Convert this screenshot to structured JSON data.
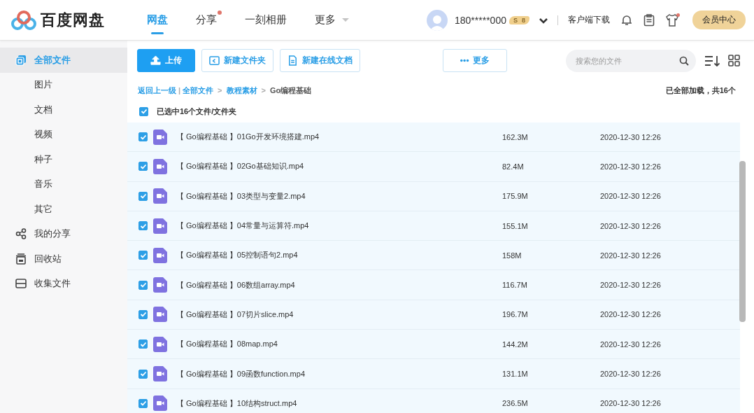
{
  "header": {
    "logo": "百度网盘",
    "tabs": [
      {
        "label": "网盘",
        "selected": true,
        "dot": false,
        "has_menu": false
      },
      {
        "label": "分享",
        "selected": false,
        "dot": true,
        "has_menu": false
      },
      {
        "label": "一刻相册",
        "selected": false,
        "dot": false,
        "has_menu": false
      },
      {
        "label": "更多",
        "selected": false,
        "dot": false,
        "has_menu": true
      }
    ],
    "user": "180*****000",
    "vip_badge": {
      "tier": "S",
      "level": "8"
    },
    "download": "客户端下载",
    "shirt_dot": true,
    "member_button": "会员中心"
  },
  "sidebar": {
    "items": [
      {
        "label": "全部文件",
        "kind": "files",
        "selected": true,
        "children": [
          {
            "label": "图片",
            "selected": false
          },
          {
            "label": "文档",
            "selected": false
          },
          {
            "label": "视频",
            "selected": false
          },
          {
            "label": "种子",
            "selected": false
          },
          {
            "label": "音乐",
            "selected": false
          },
          {
            "label": "其它",
            "selected": false
          }
        ]
      },
      {
        "label": "我的分享",
        "kind": "share",
        "selected": false
      },
      {
        "label": "回收站",
        "kind": "trash",
        "selected": false
      },
      {
        "label": "收集文件",
        "kind": "collect",
        "selected": false
      }
    ]
  },
  "toolbar": {
    "buttons": [
      {
        "label": "上传",
        "kind": "primary"
      },
      {
        "label": "新建文件夹",
        "kind": "folder"
      },
      {
        "label": "新建在线文档",
        "kind": "doc"
      },
      {
        "label": "更多",
        "kind": "more"
      }
    ],
    "search": {
      "placeholder": "搜索您的文件"
    }
  },
  "breadcrumb": {
    "items": [
      {
        "kind": "link",
        "label": "返回上一级"
      },
      {
        "kind": "separator",
        "label": "|"
      },
      {
        "kind": "link",
        "label": "全部文件"
      },
      {
        "kind": "separator",
        "label": ">"
      },
      {
        "kind": "link",
        "label": "教程素材"
      },
      {
        "kind": "separator",
        "label": ">"
      },
      {
        "kind": "current",
        "label": "Go编程基础"
      }
    ],
    "status": "已全部加载，共16个"
  },
  "select_all": {
    "checked": true,
    "label": "已选中16个文件/文件夹"
  },
  "files": [
    {
      "name": "【 Go编程基础 】01Go开发环境搭建.mp4",
      "size": "162.3M",
      "date": "2020-12-30 12:26",
      "selected": true
    },
    {
      "name": "【 Go编程基础 】02Go基础知识.mp4",
      "size": "82.4M",
      "date": "2020-12-30 12:26",
      "selected": true
    },
    {
      "name": "【 Go编程基础 】03类型与变量2.mp4",
      "size": "175.9M",
      "date": "2020-12-30 12:26",
      "selected": true
    },
    {
      "name": "【 Go编程基础 】04常量与运算符.mp4",
      "size": "155.1M",
      "date": "2020-12-30 12:26",
      "selected": true
    },
    {
      "name": "【 Go编程基础 】05控制语句2.mp4",
      "size": "158M",
      "date": "2020-12-30 12:26",
      "selected": true
    },
    {
      "name": "【 Go编程基础 】06数组array.mp4",
      "size": "116.7M",
      "date": "2020-12-30 12:26",
      "selected": true
    },
    {
      "name": "【 Go编程基础 】07切片slice.mp4",
      "size": "196.7M",
      "date": "2020-12-30 12:26",
      "selected": true
    },
    {
      "name": "【 Go编程基础 】08map.mp4",
      "size": "144.2M",
      "date": "2020-12-30 12:26",
      "selected": true
    },
    {
      "name": "【 Go编程基础 】09函数function.mp4",
      "size": "131.1M",
      "date": "2020-12-30 12:26",
      "selected": true
    },
    {
      "name": "【 Go编程基础 】10结构struct.mp4",
      "size": "236.5M",
      "date": "2020-12-30 12:26",
      "selected": true
    }
  ]
}
